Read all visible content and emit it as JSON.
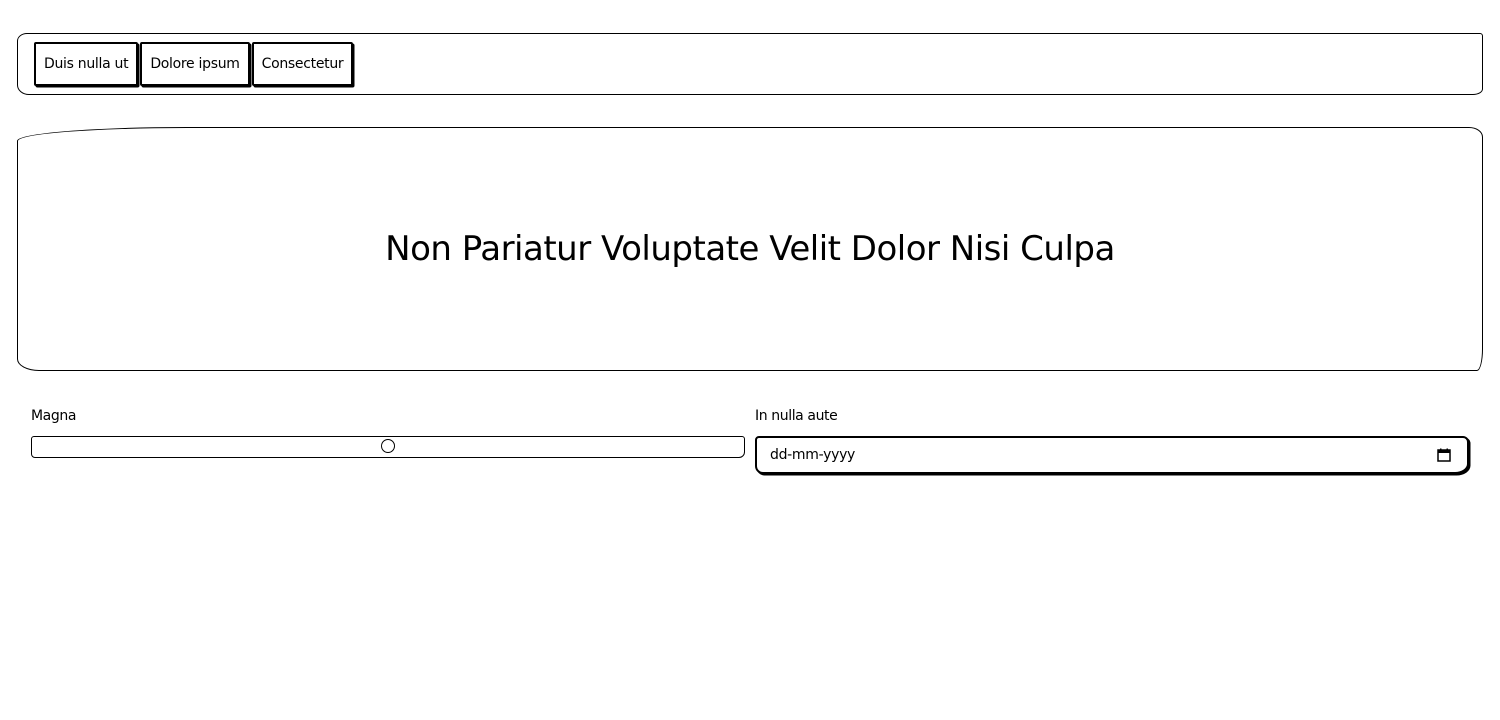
{
  "navbar": {
    "buttons": [
      {
        "label": "Duis nulla ut"
      },
      {
        "label": "Dolore ipsum"
      },
      {
        "label": "Consectetur"
      }
    ]
  },
  "hero": {
    "title": "Non Pariatur Voluptate Velit Dolor Nisi Culpa"
  },
  "form": {
    "magna": {
      "label": "Magna",
      "value_percent": 50
    },
    "aute": {
      "label": "In nulla aute",
      "placeholder": "dd-mm-yyyy",
      "icon": "calendar-icon"
    }
  }
}
